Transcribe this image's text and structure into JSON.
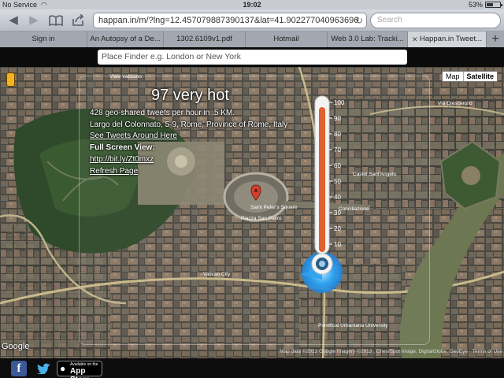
{
  "status_bar": {
    "carrier": "No Service",
    "time": "19:02",
    "battery": "53%"
  },
  "toolbar": {
    "url": "happan.in/m/?lng=12.457079887390137&lat=41.902277040963696",
    "search_placeholder": "Search"
  },
  "tabs": [
    {
      "label": "Sign in",
      "active": false
    },
    {
      "label": "An Autopsy of a De...",
      "active": false
    },
    {
      "label": "1302.6109v1.pdf",
      "active": false
    },
    {
      "label": "Hotmail",
      "active": false
    },
    {
      "label": "Web 3.0 Lab: Tracki...",
      "active": false
    },
    {
      "label": "Happan.in Tweet...",
      "active": true
    }
  ],
  "place_finder": {
    "placeholder": "Place Finder e.g. London or New York"
  },
  "info": {
    "temperature": "97 very hot",
    "rate": "428 geo-shared tweets per hour in .5 KM.",
    "address": "Largo del Colonnato, 5-9, Rome, Province of Rome, Italy",
    "see_tweets": "See Tweets Around Here",
    "full_screen_label": "Full Screen View:",
    "short_url": "http://bit.ly/Zt0mxz",
    "refresh": "Refresh Page"
  },
  "thermometer": {
    "value": 97,
    "min": 0,
    "max": 100,
    "ticks": [
      "100",
      "90",
      "80",
      "70",
      "60",
      "50",
      "40",
      "30",
      "20",
      "10"
    ]
  },
  "map_type": {
    "map": "Map",
    "satellite": "Satellite",
    "selected": "Satellite"
  },
  "map_labels": {
    "pin_label": "Saint Peter's Square",
    "piazza": "Piazza San Pietro",
    "vatican": "Vatican City",
    "viale_vaticano": "Viale Vaticano",
    "via_crescenzio": "Via Crescenzio",
    "castel": "Castel Sant'Angelo",
    "conciliazione": "Conciliazione",
    "pontifical": "Pontifical Urbaniana University"
  },
  "attribution": {
    "google": "Google",
    "copyright": "Map data ©2013 Google Imagery ©2013 , Cnes/Spot Image, DigitalGlobe, GeoEye · Terms of Use"
  },
  "app_store": {
    "available": "Available on the",
    "store": "App Store"
  },
  "colors": {
    "mercury": "#e06030",
    "glow": "#2aa0f0",
    "url_bar": "#ffffff"
  }
}
